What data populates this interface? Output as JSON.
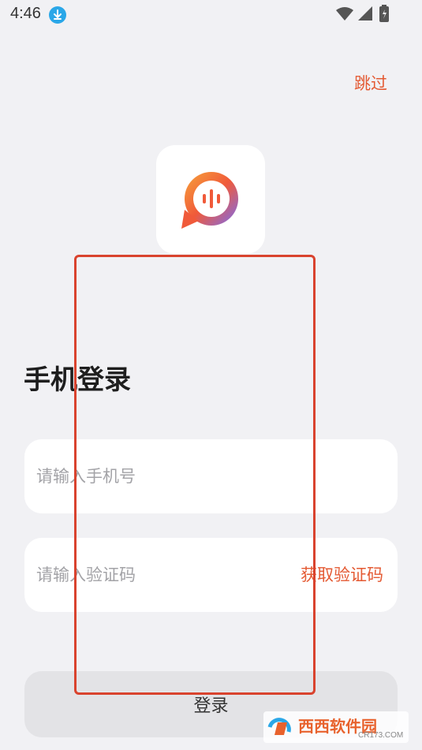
{
  "status_bar": {
    "time": "4:46",
    "icons": [
      "download-icon",
      "wifi-icon",
      "signal-icon",
      "battery-icon"
    ]
  },
  "header": {
    "skip_label": "跳过"
  },
  "logo": {
    "icon": "chat-bubble-voice-icon",
    "colors": [
      "#f05a3a",
      "#f7a33a",
      "#7a6cf0"
    ]
  },
  "title": "手机登录",
  "phone_input": {
    "placeholder": "请输入手机号",
    "value": ""
  },
  "code_input": {
    "placeholder": "请输入验证码",
    "value": "",
    "get_code_label": "获取验证码"
  },
  "login_button": {
    "label": "登录"
  },
  "watermark": {
    "text": "西西软件园",
    "sub": "CR173.COM"
  },
  "colors": {
    "accent": "#e45a33",
    "background": "#f1f1f4",
    "annotation": "#d9432e"
  }
}
